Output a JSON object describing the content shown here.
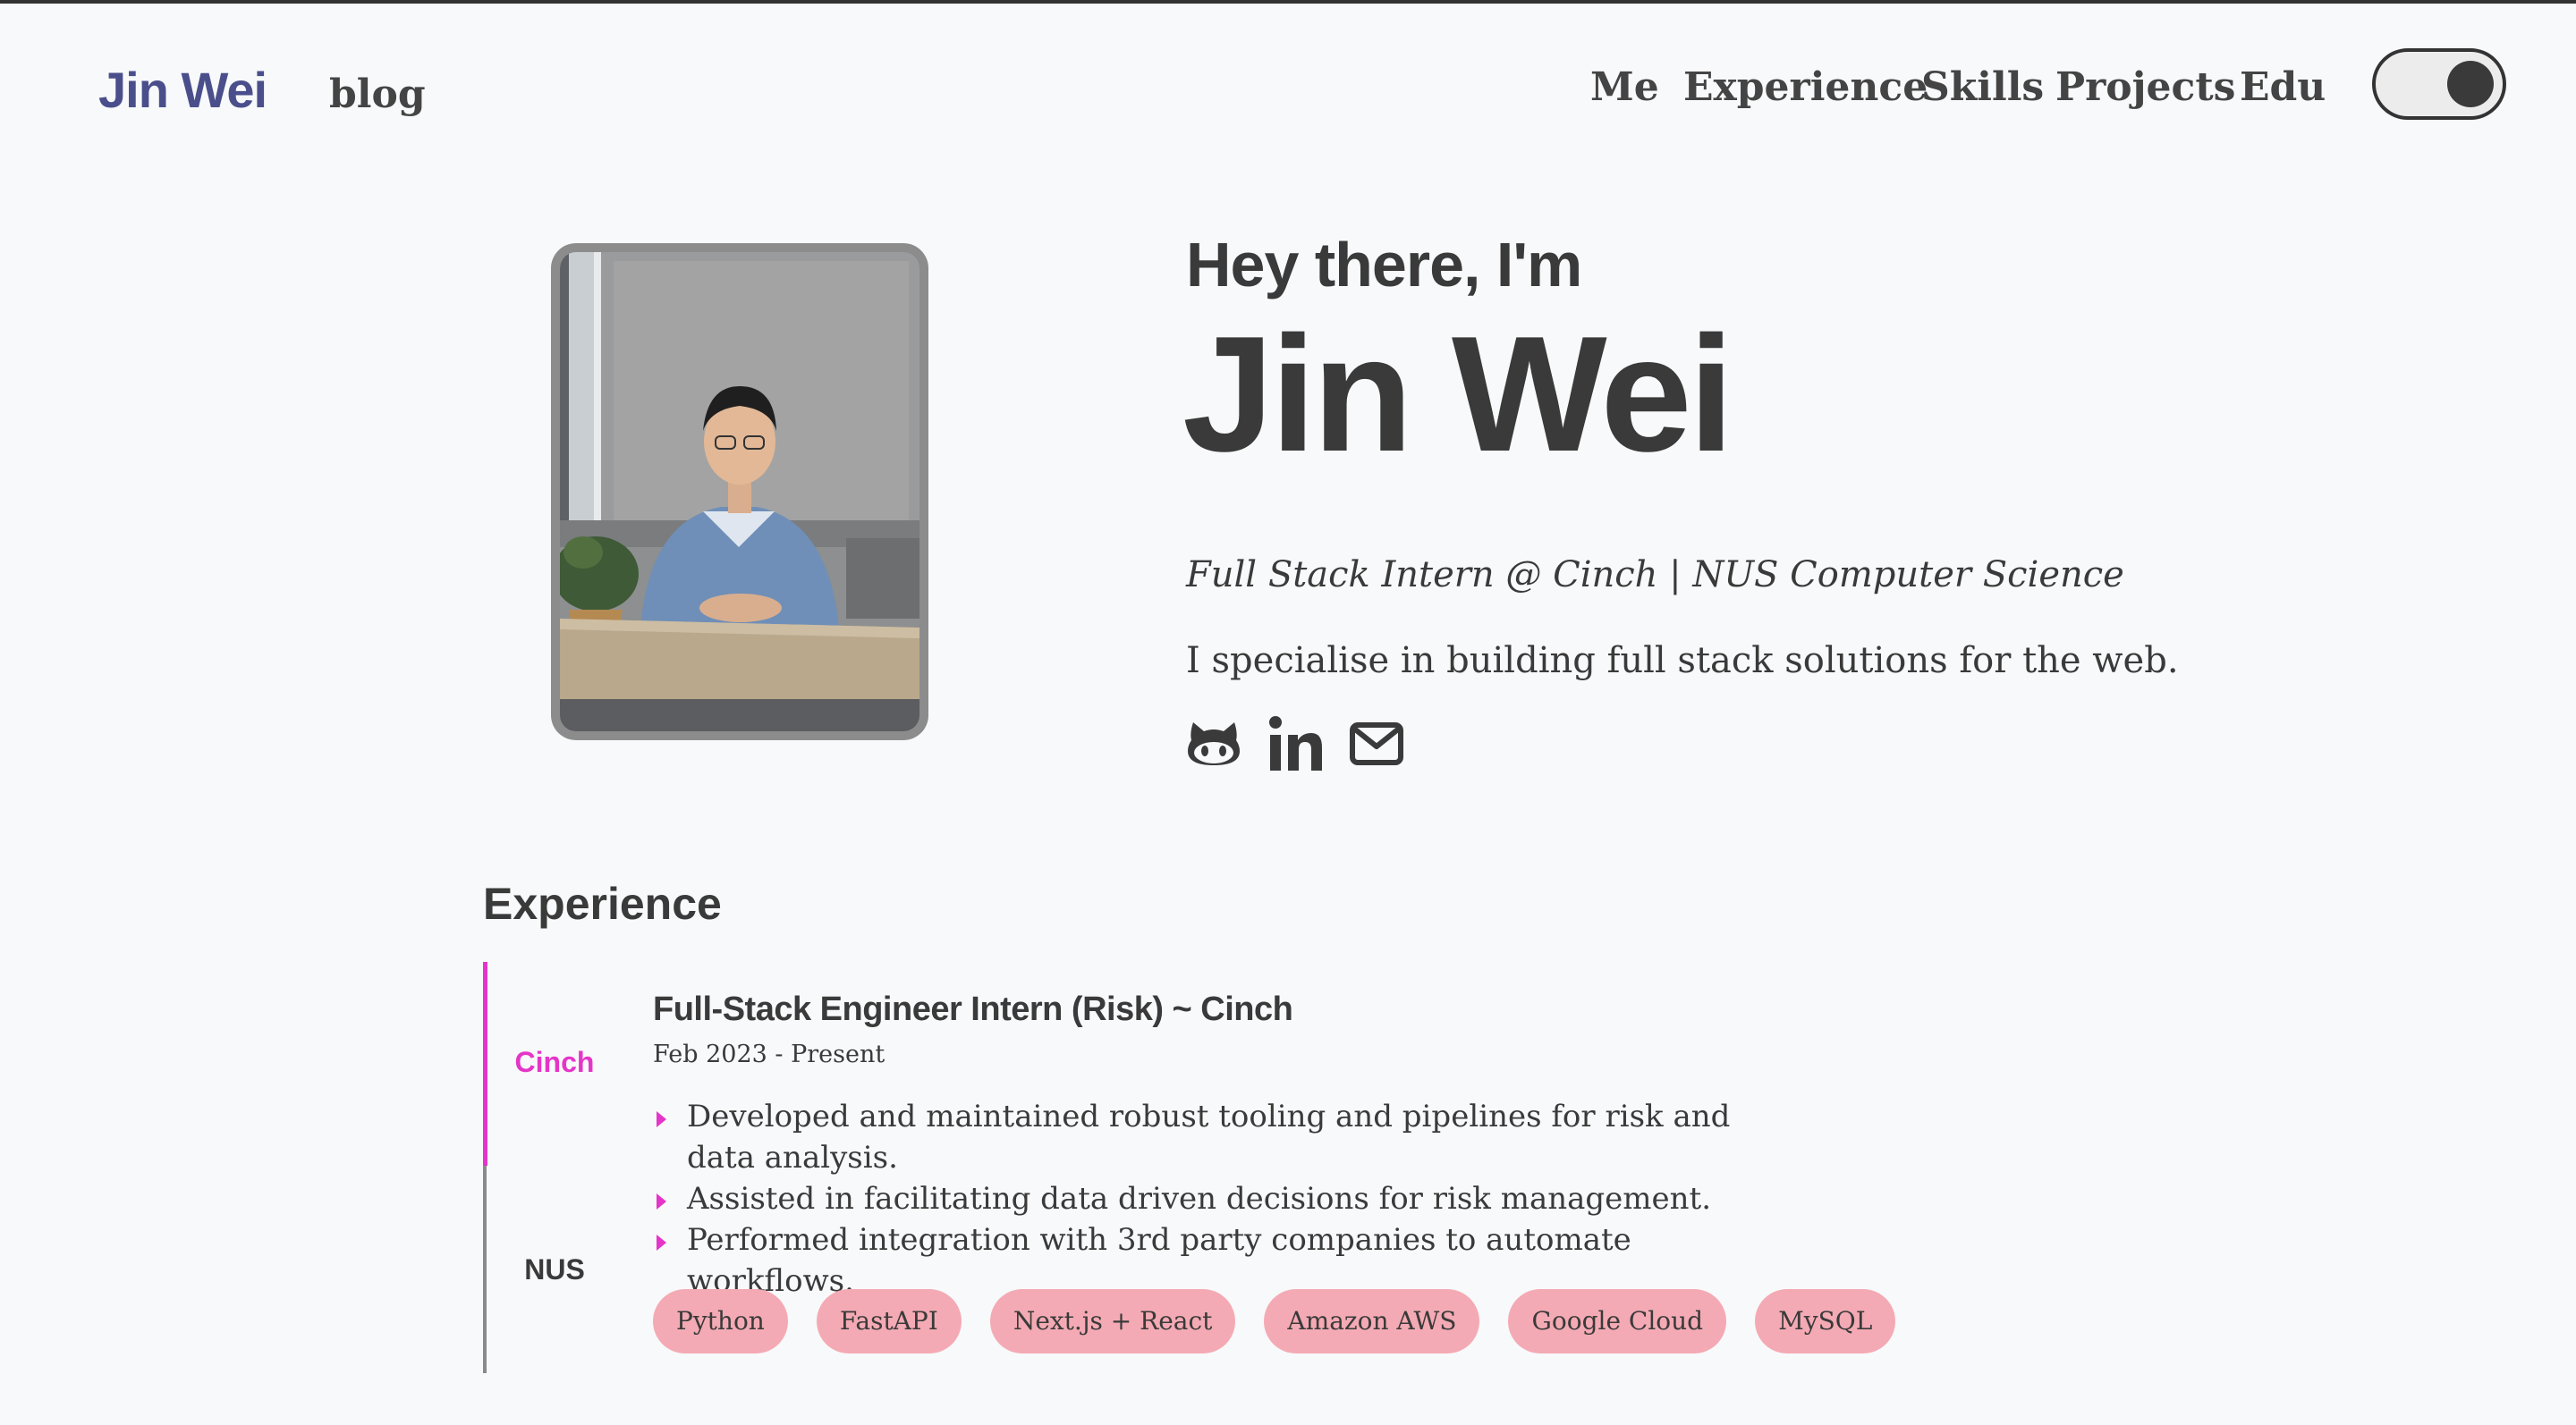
{
  "header": {
    "brand": "Jin Wei",
    "blog_label": "blog",
    "nav": [
      "Me",
      "Experience",
      "Skills",
      "Projects",
      "Edu"
    ]
  },
  "theme_toggle": {
    "state": "on",
    "knob_color": "#3a3a3a"
  },
  "hero": {
    "greeting": "Hey there, I'm",
    "name": "Jin Wei",
    "tagline": "Full Stack Intern @ Cinch | NUS Computer Science",
    "intro": "I specialise in building full stack solutions for the web.",
    "socials": [
      "github-icon",
      "linkedin-icon",
      "email-icon"
    ]
  },
  "experience": {
    "section_title": "Experience",
    "tabs": [
      "Cinch",
      "NUS"
    ],
    "active_tab": "Cinch",
    "job": {
      "title": "Full-Stack Engineer Intern (Risk) ~ Cinch",
      "dates": "Feb 2023 - Present",
      "bullets": [
        "Developed and maintained robust tooling and pipelines for risk and data analysis.",
        "Assisted in facilitating data driven decisions for risk management.",
        "Performed integration with 3rd party companies to automate workflows."
      ],
      "tags": [
        "Python",
        "FastAPI",
        "Next.js + React",
        "Amazon AWS",
        "Google Cloud",
        "MySQL"
      ]
    }
  },
  "colors": {
    "brand": "#4a4f8c",
    "accent": "#e535c8",
    "tag_bg": "#f4aab4",
    "text": "#3a3a3a",
    "background": "#f8f9fa"
  }
}
